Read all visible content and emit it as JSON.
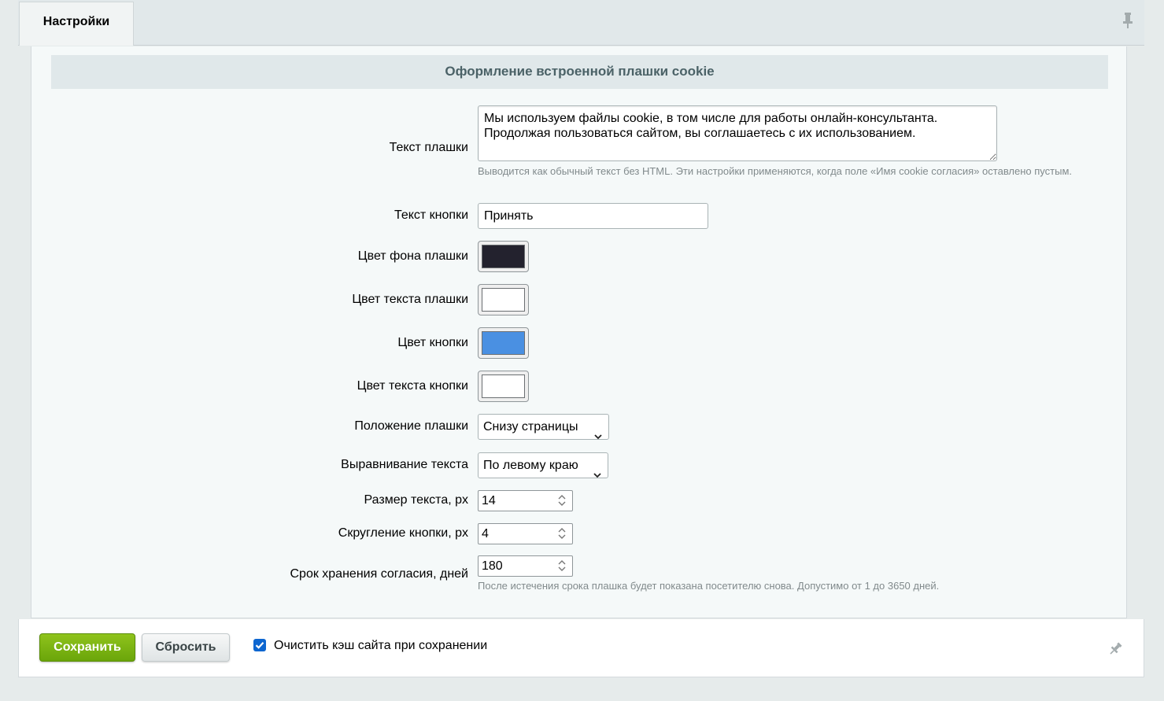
{
  "tab": {
    "label": "Настройки"
  },
  "section": {
    "title": "Оформление встроенной плашки cookie"
  },
  "fields": {
    "banner_text": {
      "label": "Текст плашки",
      "value": "Мы используем файлы cookie, в том числе для работы онлайн-консультанта. Продолжая пользоваться сайтом, вы соглашаетесь с их использованием.",
      "hint": "Выводится как обычный текст без HTML. Эти настройки применяются, когда поле «Имя cookie согласия» оставлено пустым."
    },
    "button_text": {
      "label": "Текст кнопки",
      "value": "Принять"
    },
    "bg_color": {
      "label": "Цвет фона плашки",
      "color": "#23222e"
    },
    "text_color": {
      "label": "Цвет текста плашки",
      "color": "#ffffff"
    },
    "button_color": {
      "label": "Цвет кнопки",
      "color": "#4a90e2"
    },
    "button_text_color": {
      "label": "Цвет текста кнопки",
      "color": "#ffffff"
    },
    "position": {
      "label": "Положение плашки",
      "value": "Снизу страницы"
    },
    "align": {
      "label": "Выравнивание текста",
      "value": "По левому краю"
    },
    "font_size": {
      "label": "Размер текста, px",
      "value": "14"
    },
    "radius": {
      "label": "Скругление кнопки, px",
      "value": "4"
    },
    "retention": {
      "label": "Срок хранения согласия, дней",
      "value": "180",
      "hint": "После истечения срока плашка будет показана посетителю снова. Допустимо от 1 до 3650 дней."
    }
  },
  "footer": {
    "save_label": "Сохранить",
    "reset_label": "Сбросить",
    "clear_cache_label": "Очистить кэш сайта при сохранении",
    "clear_cache_checked": true
  },
  "colors": {
    "accent_green": "#7ab317",
    "checkbox_blue": "#0d66d0"
  },
  "icons": {
    "top_right": "pin-icon",
    "bottom_right": "pin-icon"
  }
}
